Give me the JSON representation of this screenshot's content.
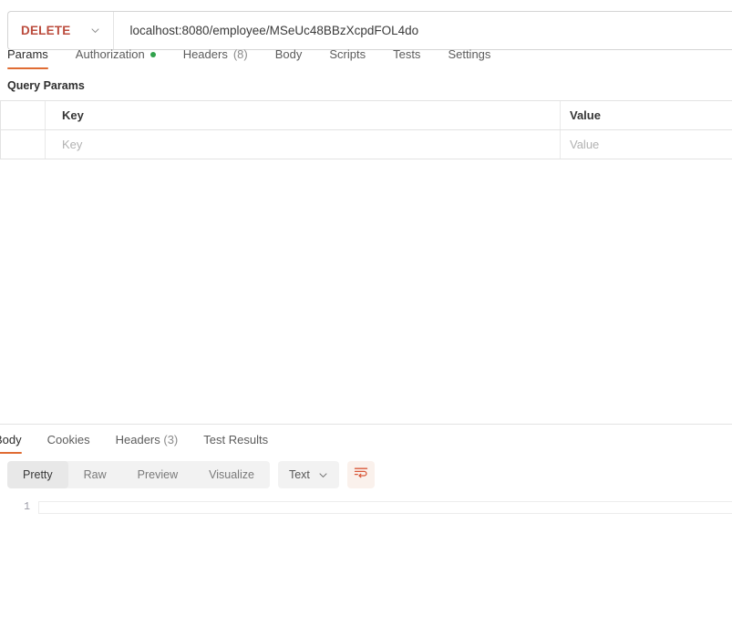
{
  "request": {
    "method": "DELETE",
    "method_chevron_icon": "chevron-down-icon",
    "url": "localhost:8080/employee/MSeUc48BBzXcpdFOL4do",
    "url_placeholder": "Enter URL or paste text",
    "tabs": [
      {
        "label": "Params",
        "active": true,
        "badge": "",
        "dot": false
      },
      {
        "label": "Authorization",
        "active": false,
        "badge": "",
        "dot": true
      },
      {
        "label": "Headers",
        "active": false,
        "badge": "(8)",
        "dot": false
      },
      {
        "label": "Body",
        "active": false,
        "badge": "",
        "dot": false
      },
      {
        "label": "Scripts",
        "active": false,
        "badge": "",
        "dot": false
      },
      {
        "label": "Tests",
        "active": false,
        "badge": "",
        "dot": false
      },
      {
        "label": "Settings",
        "active": false,
        "badge": "",
        "dot": false
      }
    ],
    "query_params": {
      "title": "Query Params",
      "columns": [
        "Key",
        "Value"
      ],
      "rows": [
        {
          "key": "",
          "value": "",
          "key_placeholder": "Key",
          "value_placeholder": "Value",
          "checked": false
        }
      ]
    }
  },
  "response": {
    "tabs": [
      {
        "label": "Body",
        "active": true,
        "badge": ""
      },
      {
        "label": "Cookies",
        "active": false,
        "badge": ""
      },
      {
        "label": "Headers",
        "active": false,
        "badge": "(3)"
      },
      {
        "label": "Test Results",
        "active": false,
        "badge": ""
      }
    ],
    "view_modes": [
      {
        "label": "Pretty",
        "active": true
      },
      {
        "label": "Raw",
        "active": false
      },
      {
        "label": "Preview",
        "active": false
      },
      {
        "label": "Visualize",
        "active": false
      }
    ],
    "format": "Text",
    "format_chevron_icon": "chevron-down-icon",
    "wrap_icon": "word-wrap-icon",
    "body_lines": [
      {
        "number": "1",
        "text": ""
      }
    ]
  },
  "colors": {
    "accent": "#e06c33",
    "method_delete": "#bb4b3c",
    "status_dot_green": "#31a24c",
    "border": "#e3e3e3",
    "muted_text": "#8b8b8b"
  }
}
